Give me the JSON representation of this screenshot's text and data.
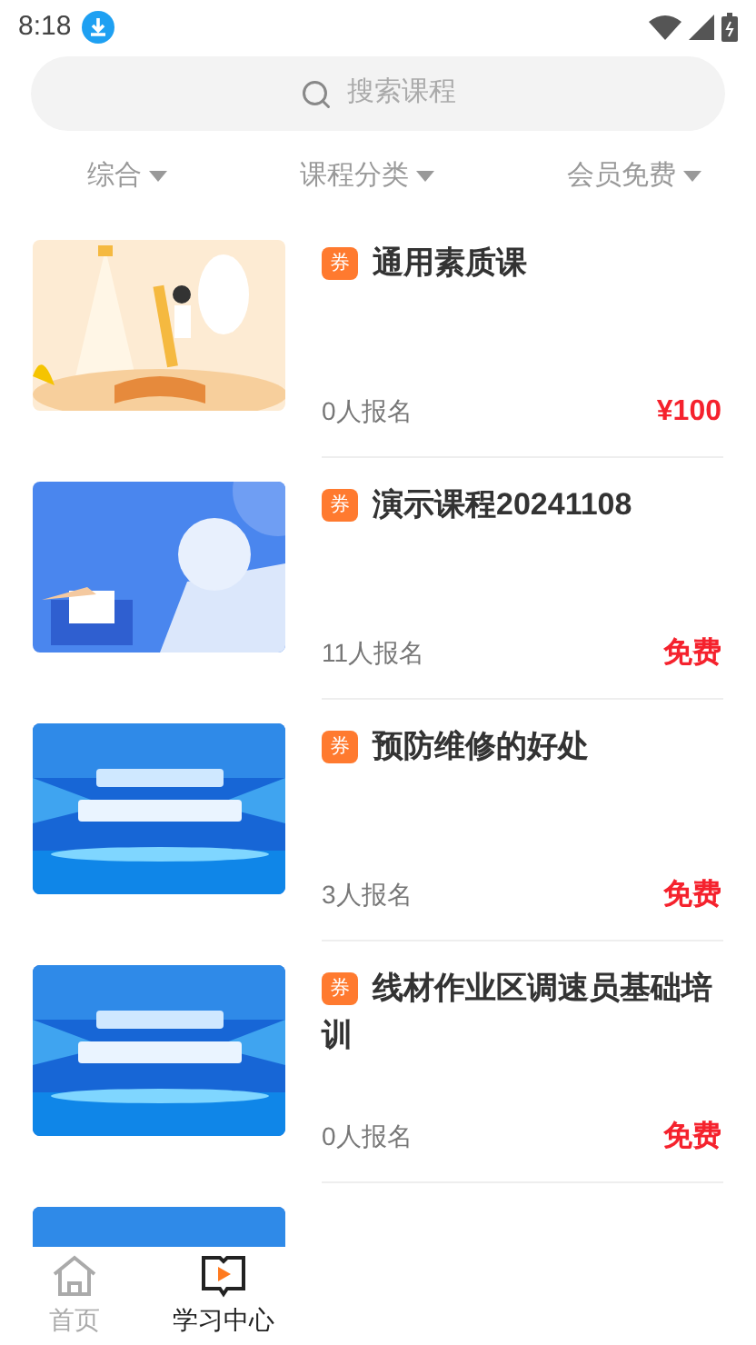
{
  "status_bar": {
    "time": "8:18"
  },
  "search": {
    "placeholder": "搜索课程"
  },
  "filters": [
    {
      "label": "综合"
    },
    {
      "label": "课程分类"
    },
    {
      "label": "会员免费"
    }
  ],
  "courses": [
    {
      "kind": "picture",
      "badge": "券",
      "title": "通用素质课",
      "enrolled": "0人报名",
      "price": "¥100"
    },
    {
      "kind": "picture",
      "badge": "券",
      "title": "演示课程20241108",
      "enrolled": "11人报名",
      "price": "免费"
    },
    {
      "kind": "picture",
      "badge": "券",
      "title": "预防维修的好处",
      "enrolled": "3人报名",
      "price": "免费"
    },
    {
      "kind": "picture",
      "badge": "券",
      "title": "线材作业区调速员基础培训",
      "enrolled": "0人报名",
      "price": "免费"
    },
    {
      "kind": "picture"
    }
  ],
  "tab_bar": [
    {
      "label": "首页",
      "selected": false
    },
    {
      "label": "学习中心",
      "selected": true
    }
  ]
}
